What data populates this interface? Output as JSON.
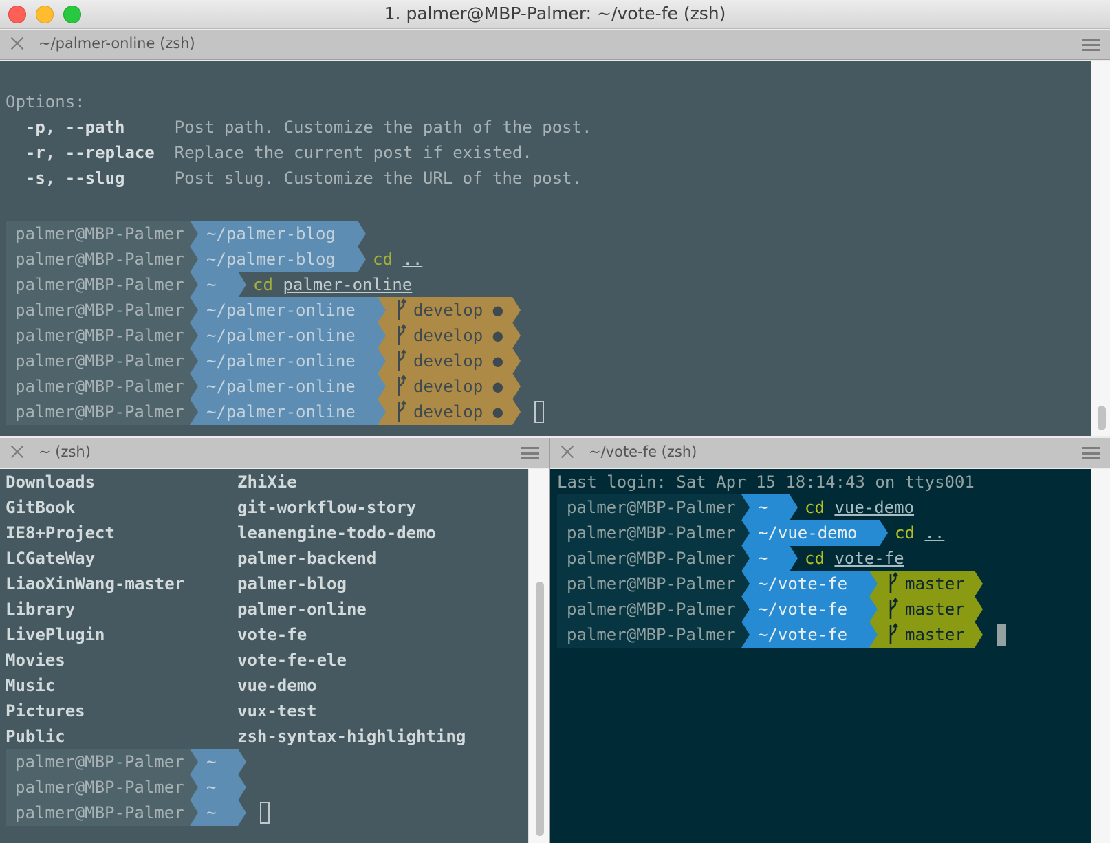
{
  "window": {
    "title": "1. palmer@MBP-Palmer: ~/vote-fe (zsh)"
  },
  "colors": {
    "pane_dark": "#465960",
    "pane_solarized": "#002b36",
    "prompt_blue_muted": "#5d8db3",
    "prompt_blue": "#268bd2",
    "branch_yellow_muted": "#ad8b47",
    "branch_green": "#8a9a13",
    "text_muted": "#a9b3b6",
    "command_green": "#859900"
  },
  "pane_top": {
    "tab_label": "~/palmer-online (zsh)",
    "help_heading": "Options:",
    "options": [
      {
        "flag": "  -p, --path   ",
        "desc": "Post path. Customize the path of the post."
      },
      {
        "flag": "  -r, --replace",
        "desc": "Replace the current post if existed."
      },
      {
        "flag": "  -s, --slug   ",
        "desc": "Post slug. Customize the URL of the post."
      }
    ],
    "prompts": [
      {
        "host": "palmer@MBP-Palmer",
        "path": "~/palmer-blog",
        "branch": "",
        "command": "",
        "arg": ""
      },
      {
        "host": "palmer@MBP-Palmer",
        "path": "~/palmer-blog",
        "branch": "",
        "command": "cd",
        "arg": ".."
      },
      {
        "host": "palmer@MBP-Palmer",
        "path": "~",
        "branch": "",
        "command": "cd",
        "arg": "palmer-online"
      },
      {
        "host": "palmer@MBP-Palmer",
        "path": "~/palmer-online",
        "branch": "develop ●",
        "command": "",
        "arg": ""
      },
      {
        "host": "palmer@MBP-Palmer",
        "path": "~/palmer-online",
        "branch": "develop ●",
        "command": "",
        "arg": ""
      },
      {
        "host": "palmer@MBP-Palmer",
        "path": "~/palmer-online",
        "branch": "develop ●",
        "command": "",
        "arg": ""
      },
      {
        "host": "palmer@MBP-Palmer",
        "path": "~/palmer-online",
        "branch": "develop ●",
        "command": "",
        "arg": ""
      },
      {
        "host": "palmer@MBP-Palmer",
        "path": "~/palmer-online",
        "branch": "develop ●",
        "command": "",
        "arg": ""
      }
    ]
  },
  "pane_bottom_left": {
    "tab_label": "~ (zsh)",
    "listing_col1": [
      "Downloads",
      "GitBook",
      "IE8+Project",
      "LCGateWay",
      "LiaoXinWang-master",
      "Library",
      "LivePlugin",
      "Movies",
      "Music",
      "Pictures",
      "Public"
    ],
    "listing_col2": [
      "ZhiXie",
      "git-workflow-story",
      "leanengine-todo-demo",
      "palmer-backend",
      "palmer-blog",
      "palmer-online",
      "vote-fe",
      "vote-fe-ele",
      "vue-demo",
      "vux-test",
      "zsh-syntax-highlighting"
    ],
    "prompts": [
      {
        "host": "palmer@MBP-Palmer",
        "path": "~"
      },
      {
        "host": "palmer@MBP-Palmer",
        "path": "~"
      },
      {
        "host": "palmer@MBP-Palmer",
        "path": "~"
      }
    ]
  },
  "pane_bottom_right": {
    "tab_label": "~/vote-fe (zsh)",
    "last_login": "Last login: Sat Apr 15 18:14:43 on ttys001",
    "prompts": [
      {
        "host": "palmer@MBP-Palmer",
        "path": "~",
        "branch": "",
        "command": "cd",
        "arg": "vue-demo"
      },
      {
        "host": "palmer@MBP-Palmer",
        "path": "~/vue-demo",
        "branch": "",
        "command": "cd",
        "arg": ".."
      },
      {
        "host": "palmer@MBP-Palmer",
        "path": "~",
        "branch": "",
        "command": "cd",
        "arg": "vote-fe"
      },
      {
        "host": "palmer@MBP-Palmer",
        "path": "~/vote-fe",
        "branch": "master",
        "command": "",
        "arg": ""
      },
      {
        "host": "palmer@MBP-Palmer",
        "path": "~/vote-fe",
        "branch": "master",
        "command": "",
        "arg": ""
      },
      {
        "host": "palmer@MBP-Palmer",
        "path": "~/vote-fe",
        "branch": "master",
        "command": "",
        "arg": ""
      }
    ]
  }
}
